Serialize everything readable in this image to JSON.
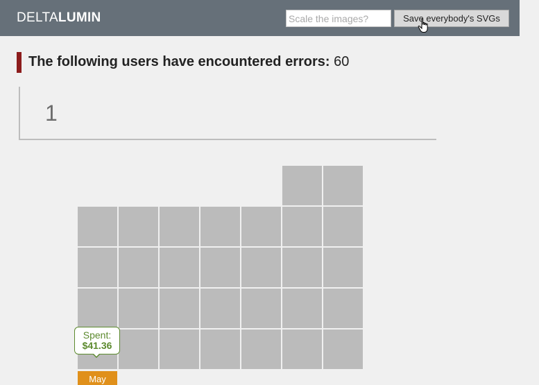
{
  "header": {
    "brand_light": "DELTA",
    "brand_bold": "LUMIN",
    "scale_input": {
      "placeholder": "Scale the images?",
      "value": ""
    },
    "save_button_label": "Save everybody's SVGs"
  },
  "headline": {
    "label": "The following users have encountered errors",
    "separator": ":",
    "count": "60"
  },
  "page_number": "1",
  "tooltip": {
    "label": "Spent:",
    "value": "$41.36"
  },
  "month_label": "May",
  "colors": {
    "header_bg": "#667079",
    "accent_bar": "#8c1c1c",
    "cell": "#bbbbbb",
    "tooltip_green": "#5c8a2e",
    "month_tab": "#e0901b"
  }
}
